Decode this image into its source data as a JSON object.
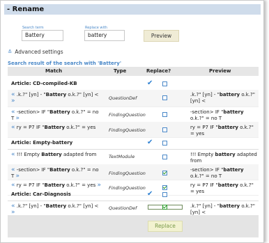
{
  "title": "- Rename",
  "search": {
    "term_label": "Search term",
    "term_value": "Battery",
    "replace_label": "Replace with",
    "replace_value": "battery",
    "preview_label": "Preview"
  },
  "advanced": {
    "label": "Advanced settings",
    "icon": "double-chevron-down"
  },
  "results": {
    "title": "Search result of the search with 'Battery'",
    "columns": [
      "Match",
      "Type",
      "Replace?",
      "Preview"
    ],
    "articles": [
      {
        "name": "Article: CD-compiled-KB",
        "all_checked": true,
        "items": [
          {
            "match_pre": ".k.?\" [yn] - \"",
            "match_bold": "Battery",
            "match_post": " o.k.?\" [yn] <",
            "type": "QuestionDef",
            "checked": false,
            "prev_pre": ".k.?\" [yn] - \"",
            "prev_bold": "battery",
            "prev_post": " o.k.?\" [yn] <"
          },
          {
            "match_pre": "-section> IF \"",
            "match_bold": "Battery",
            "match_post": " o.k.?\" = no T",
            "type": "FindingQuestion",
            "checked": false,
            "prev_pre": "-section> IF \"",
            "prev_bold": "battery",
            "prev_post": " o.k.?\" = no T"
          },
          {
            "match_pre": "ry = P7 IF \"",
            "match_bold": "Battery",
            "match_post": " o.k.?\" = yes",
            "type": "FindingQuestion",
            "checked": false,
            "prev_pre": "ry = P7 IF \"",
            "prev_bold": "battery",
            "prev_post": " o.k.?\" = yes"
          }
        ]
      },
      {
        "name": "Article: Empty-battery",
        "all_checked": true,
        "items": [
          {
            "match_pre": "!!! Empty ",
            "match_bold": "Battery",
            "match_post": " adapted from",
            "type": "TextModule",
            "checked": false,
            "prev_pre": "!!! Empty ",
            "prev_bold": "battery",
            "prev_post": " adapted from"
          },
          {
            "match_pre": "-section> IF \"",
            "match_bold": "Battery",
            "match_post": " o.k.?\" = no T",
            "type": "FindingQuestion",
            "checked": true,
            "prev_pre": "-section> IF \"",
            "prev_bold": "battery",
            "prev_post": " o.k.?\" = no T"
          },
          {
            "match_pre": "ry = P7 IF \"",
            "match_bold": "Battery",
            "match_post": " o.k.?\" = yes",
            "type": "FindingQuestion",
            "checked": true,
            "prev_pre": "ry = P7 IF \"",
            "prev_bold": "battery",
            "prev_post": " o.k.?\" = yes"
          }
        ]
      },
      {
        "name": "Article: Car-Diagnosis",
        "all_checked": true,
        "items": [
          {
            "match_pre": ".k.?\" [yn] - \"",
            "match_bold": "Battery",
            "match_post": " o.k.?\" [yn] <",
            "type": "QuestionDef",
            "checked": true,
            "prev_pre": ".k.?\" [yn] - \"",
            "prev_bold": "battery",
            "prev_post": " o.k.?\" [yn] <"
          }
        ]
      }
    ]
  },
  "replace_label": "Replace",
  "colors": {
    "accent": "#4a88c8",
    "title_bg": "#cfdceb",
    "check_green": "#2a9a2a"
  }
}
